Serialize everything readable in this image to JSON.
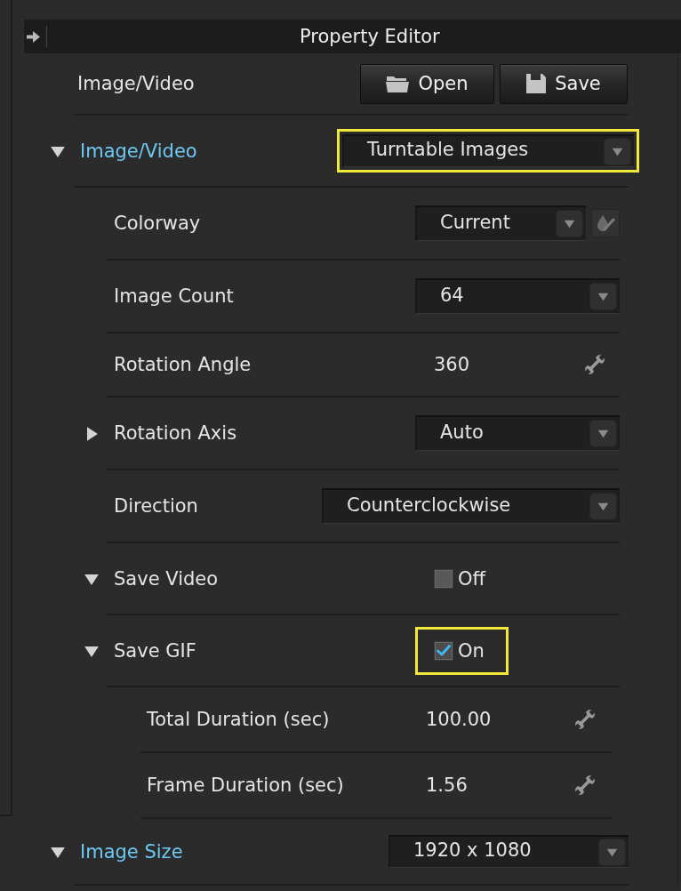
{
  "panel": {
    "title": "Property Editor"
  },
  "file_row": {
    "label": "Image/Video",
    "buttons": [
      {
        "label": "Open"
      },
      {
        "label": "Save"
      }
    ]
  },
  "sections": [
    {
      "label": "Image/Video",
      "expanded": true,
      "value": "Turntable Images",
      "highlighted": true,
      "properties": [
        {
          "kind": "dropdown",
          "label": "Colorway",
          "value": "Current",
          "picker_button": true
        },
        {
          "kind": "dropdown",
          "label": "Image Count",
          "value": "64"
        },
        {
          "kind": "number",
          "label": "Rotation Angle",
          "value": "360"
        },
        {
          "kind": "dropdown",
          "label": "Rotation Axis",
          "value": "Auto",
          "expanded": false
        },
        {
          "kind": "dropdown",
          "label": "Direction",
          "value": "Counterclockwise"
        },
        {
          "kind": "checkbox",
          "label": "Save Video",
          "expanded": true,
          "checked": false,
          "value": "Off"
        },
        {
          "kind": "checkbox",
          "label": "Save GIF",
          "expanded": true,
          "checked": true,
          "value": "On",
          "highlighted": true,
          "children": [
            {
              "kind": "number",
              "label": "Total Duration (sec)",
              "value": "100.00"
            },
            {
              "kind": "number",
              "label": "Frame Duration (sec)",
              "value": "1.56"
            }
          ]
        }
      ]
    },
    {
      "label": "Image Size",
      "expanded": true,
      "value": "1920 x 1080"
    }
  ]
}
